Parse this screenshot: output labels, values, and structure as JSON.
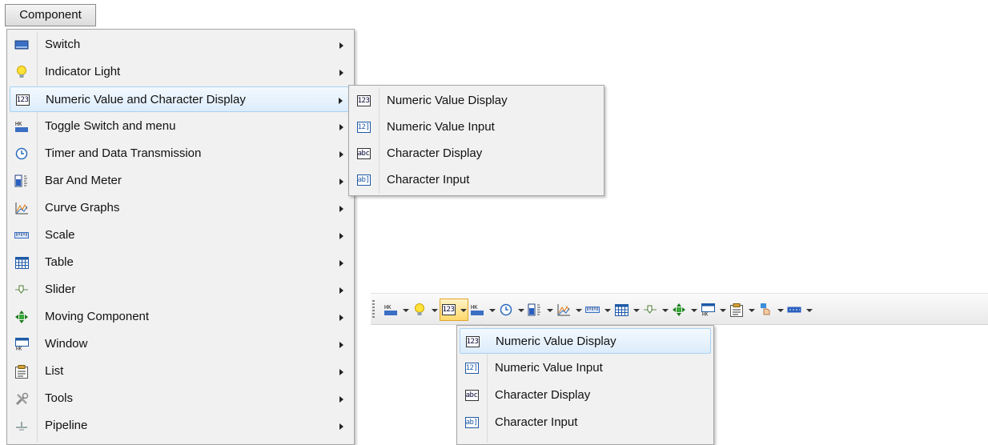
{
  "menubar": {
    "component_label": "Component"
  },
  "main_menu": {
    "items": [
      {
        "label": "Switch",
        "icon": "switch-icon"
      },
      {
        "label": "Indicator Light",
        "icon": "lightbulb-icon"
      },
      {
        "label": "Numeric Value and Character Display",
        "icon": "numeric-123-icon"
      },
      {
        "label": "Toggle Switch and menu",
        "icon": "toggle-switch-icon"
      },
      {
        "label": "Timer and Data Transmission",
        "icon": "clock-icon"
      },
      {
        "label": "Bar And Meter",
        "icon": "bar-meter-icon"
      },
      {
        "label": "Curve Graphs",
        "icon": "curve-graph-icon"
      },
      {
        "label": "Scale",
        "icon": "scale-icon"
      },
      {
        "label": "Table",
        "icon": "table-icon"
      },
      {
        "label": "Slider",
        "icon": "slider-icon"
      },
      {
        "label": "Moving Component",
        "icon": "move-arrows-icon"
      },
      {
        "label": "Window",
        "icon": "window-icon"
      },
      {
        "label": "List",
        "icon": "list-icon"
      },
      {
        "label": "Tools",
        "icon": "tools-icon"
      },
      {
        "label": "Pipeline",
        "icon": "pipeline-icon"
      }
    ]
  },
  "submenu": {
    "items": [
      {
        "label": "Numeric Value Display",
        "icon_text": "123"
      },
      {
        "label": "Numeric Value Input",
        "icon_text": "12]"
      },
      {
        "label": "Character Display",
        "icon_text": "abc"
      },
      {
        "label": "Character Input",
        "icon_text": "ab]"
      }
    ]
  },
  "toolbar_dropdown": {
    "items": [
      {
        "label": "Numeric Value Display",
        "icon_text": "123"
      },
      {
        "label": "Numeric Value Input",
        "icon_text": "12]"
      },
      {
        "label": "Character Display",
        "icon_text": "abc"
      },
      {
        "label": "Character Input",
        "icon_text": "ab]"
      }
    ]
  },
  "colors": {
    "highlight_border": "#a8d2f3",
    "toolbar_active": "#ffd86b"
  }
}
